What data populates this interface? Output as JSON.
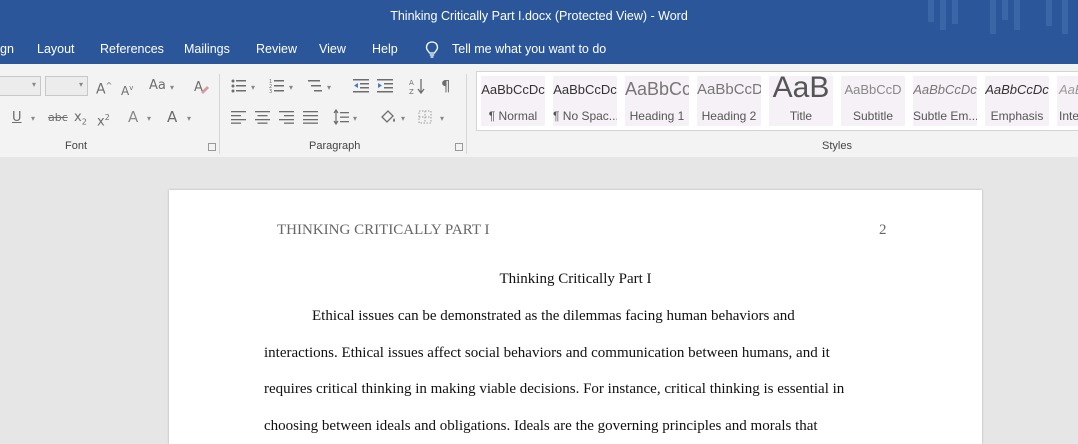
{
  "window": {
    "title": "Thinking Critically Part I.docx (Protected View)  -  Word"
  },
  "colors": {
    "titlebar": "#2b579a",
    "ribbon": "#f3f3f3",
    "canvas": "#e6e6e6"
  },
  "menu": {
    "tabs": [
      "gn",
      "Layout",
      "References",
      "Mailings",
      "Review",
      "View",
      "Help"
    ],
    "tell_me_icon": "lightbulb-icon",
    "tell_me": "Tell me what you want to do"
  },
  "ribbon": {
    "font_group": {
      "label": "Font",
      "grow_font": "A",
      "shrink_font": "A",
      "change_case": "Aa",
      "underline": "U",
      "strikethrough": "abc",
      "subscript": "x",
      "superscript": "x",
      "text_effects": "A",
      "font_color": "A"
    },
    "paragraph_group": {
      "label": "Paragraph",
      "show_marks": "¶"
    },
    "styles_group": {
      "label": "Styles",
      "styles": [
        {
          "sample": "AaBbCcDc",
          "name": "¶ Normal"
        },
        {
          "sample": "AaBbCcDc",
          "name": "¶ No Spac..."
        },
        {
          "sample": "AaBbCc",
          "name": "Heading 1"
        },
        {
          "sample": "AaBbCcD",
          "name": "Heading 2"
        },
        {
          "sample": "AaB",
          "name": "Title"
        },
        {
          "sample": "AaBbCcD",
          "name": "Subtitle"
        },
        {
          "sample": "AaBbCcDc",
          "name": "Subtle Em..."
        },
        {
          "sample": "AaBbCcDc",
          "name": "Emphasis"
        },
        {
          "sample": "AaBbCcDc",
          "name": "Inte"
        }
      ]
    }
  },
  "document": {
    "running_head": "THINKING CRITICALLY PART I",
    "page_number": "2",
    "title": "Thinking Critically Part I",
    "lines": [
      "Ethical issues can be demonstrated as the dilemmas facing human behaviors and",
      "interactions. Ethical issues affect social behaviors and communication between humans, and it",
      "requires critical thinking in making viable decisions. For instance, critical thinking is essential in",
      "choosing between ideals and obligations. Ideals are the governing principles and morals that"
    ]
  }
}
